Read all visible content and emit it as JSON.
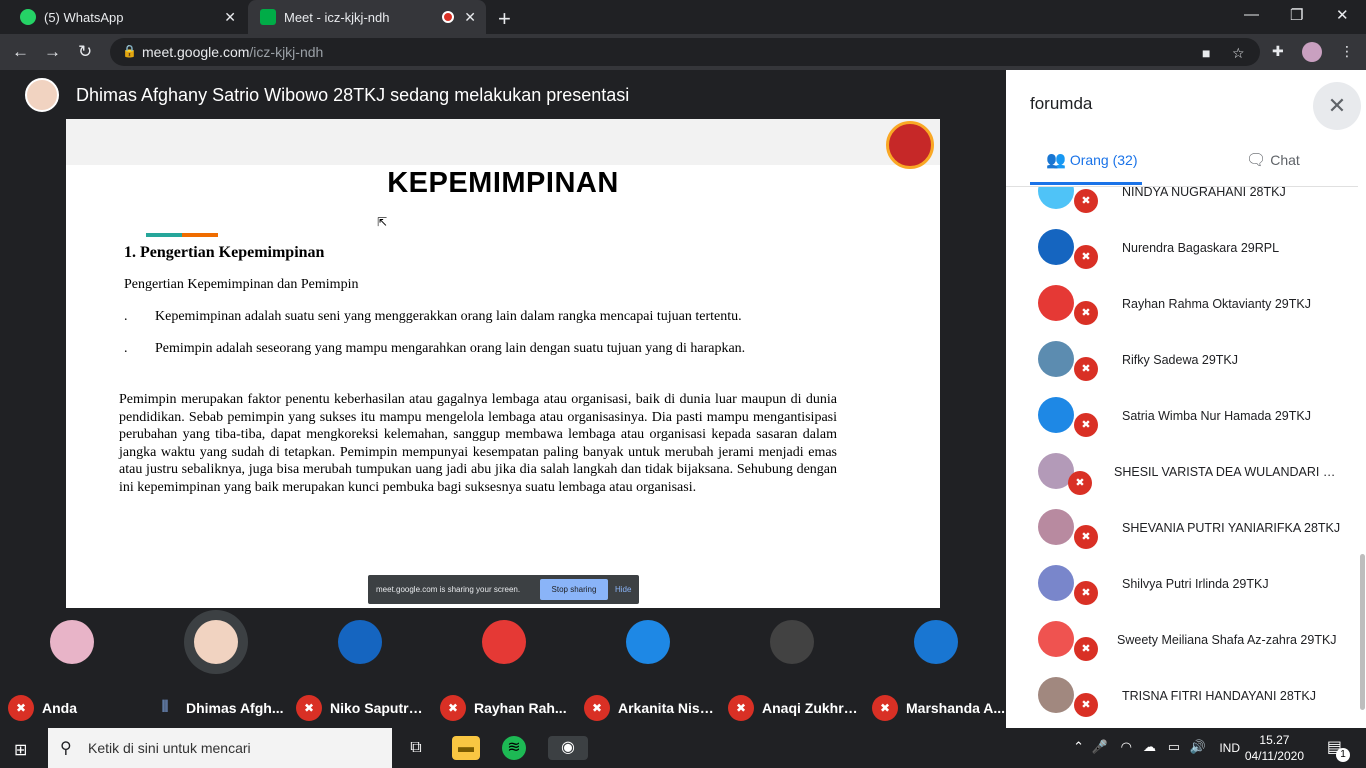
{
  "browser": {
    "tabs": [
      {
        "title": "(5) WhatsApp"
      },
      {
        "title": "Meet - icz-kjkj-ndh"
      }
    ],
    "url_host": "meet.google.com",
    "url_path": "/icz-kjkj-ndh"
  },
  "meet": {
    "presenting_text": "Dhimas Afghany Satrio Wibowo 28TKJ sedang melakukan presentasi",
    "slide": {
      "title": "KEPEMIMPINAN",
      "section": "1.   Pengertian Kepemimpinan",
      "subtitle": "Pengertian  Kepemimpinan dan Pemimpin",
      "bullets": [
        "Kepemimpinan adalah suatu seni yang menggerakkan orang lain dalam rangka mencapai tujuan tertentu.",
        "Pemimpin adalah seseorang yang mampu mengarahkan orang lain dengan suatu tujuan yang di harapkan."
      ],
      "bullet_mark": ".",
      "paragraph": "Pemimpin merupakan faktor penentu keberhasilan atau gagalnya lembaga atau organisasi, baik di dunia luar maupun di dunia pendidikan. Sebab pemimpin yang sukses itu mampu mengelola lembaga atau organisasinya. Dia pasti mampu mengantisipasi perubahan yang tiba-tiba, dapat mengkoreksi kelemahan, sanggup membawa lembaga atau organisasi kepada sasaran dalam jangka waktu yang sudah di tetapkan. Pemimpin mempunyai kesempatan paling banyak untuk merubah jerami menjadi emas atau justru sebaliknya, juga bisa merubah tumpukan uang jadi abu jika dia salah langkah dan tidak bijaksana. Sehubung dengan ini kepemimpinan yang baik merupakan kunci pembuka bagi suksesnya suatu lembaga atau organisasi."
    },
    "share_bar": {
      "message": "meet.google.com is sharing your screen.",
      "stop": "Stop sharing",
      "hide": "Hide"
    },
    "participants": [
      {
        "name": "Anda",
        "muted": true
      },
      {
        "name": "Dhimas Afgh...",
        "muted": false
      },
      {
        "name": "Niko Saputra ...",
        "muted": true
      },
      {
        "name": "Rayhan Rah...",
        "muted": true
      },
      {
        "name": "Arkanita Nisy...",
        "muted": true
      },
      {
        "name": "Anaqi Zukhru...",
        "muted": true
      },
      {
        "name": "Marshanda A...",
        "muted": true
      }
    ]
  },
  "panel": {
    "title": "forumda",
    "tab_people": "Orang (32)",
    "tab_chat": "Chat",
    "people": [
      "NINDYA NUGRAHANI 28TKJ",
      "Nurendra Bagaskara 29RPL",
      "Rayhan Rahma Oktavianty 29TKJ",
      "Rifky Sadewa 29TKJ",
      "Satria Wimba Nur Hamada 29TKJ",
      "SHESIL VARISTA DEA WULANDARI 28...",
      "SHEVANIA PUTRI YANIARIFKA 28TKJ",
      "Shilvya Putri Irlinda 29TKJ",
      "Sweety Meiliana Shafa Az-zahra 29TKJ",
      "TRISNA FITRI HANDAYANI 28TKJ"
    ]
  },
  "taskbar": {
    "search_placeholder": "Ketik di sini untuk mencari",
    "lang": "IND",
    "time": "15.27",
    "date": "04/11/2020",
    "notif_count": "1"
  }
}
